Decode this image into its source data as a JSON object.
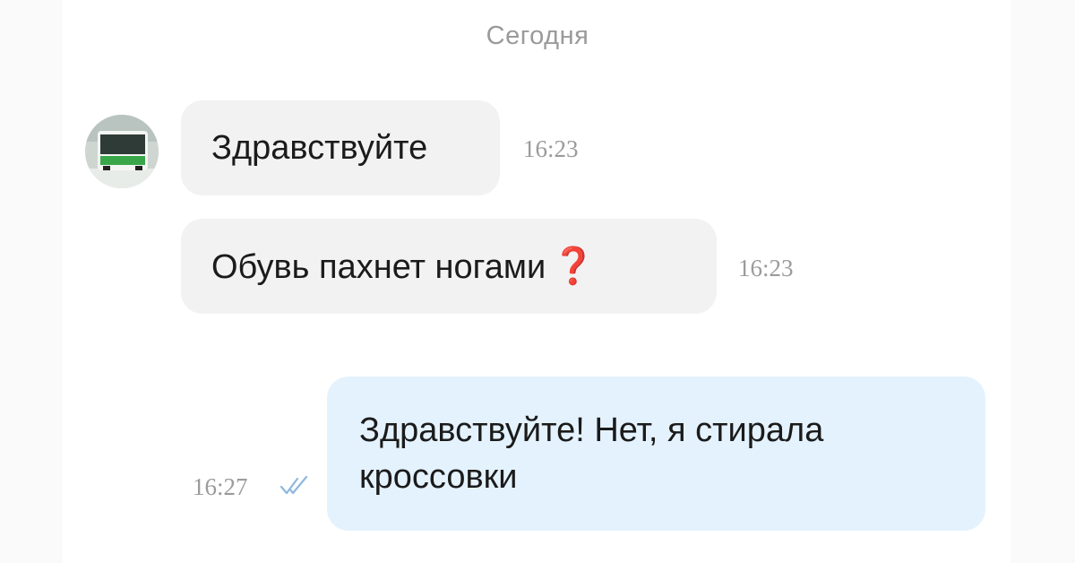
{
  "chat": {
    "date_separator": "Сегодня",
    "messages": [
      {
        "direction": "incoming",
        "text": "Здравствуйте",
        "time": "16:23"
      },
      {
        "direction": "incoming",
        "text": "Обувь пахнет ногами",
        "emoji": "❓",
        "time": "16:23"
      },
      {
        "direction": "outgoing",
        "text": "Здравствуйте! Нет, я стирала кроссовки",
        "time": "16:27",
        "status_icon": "double-check-icon"
      }
    ]
  },
  "colors": {
    "incoming_bubble": "#f2f2f2",
    "outgoing_bubble": "#e4f2fd",
    "timestamp": "#9b9b9b",
    "read_check": "#8fb8de",
    "question_mark": "#e0262d"
  }
}
